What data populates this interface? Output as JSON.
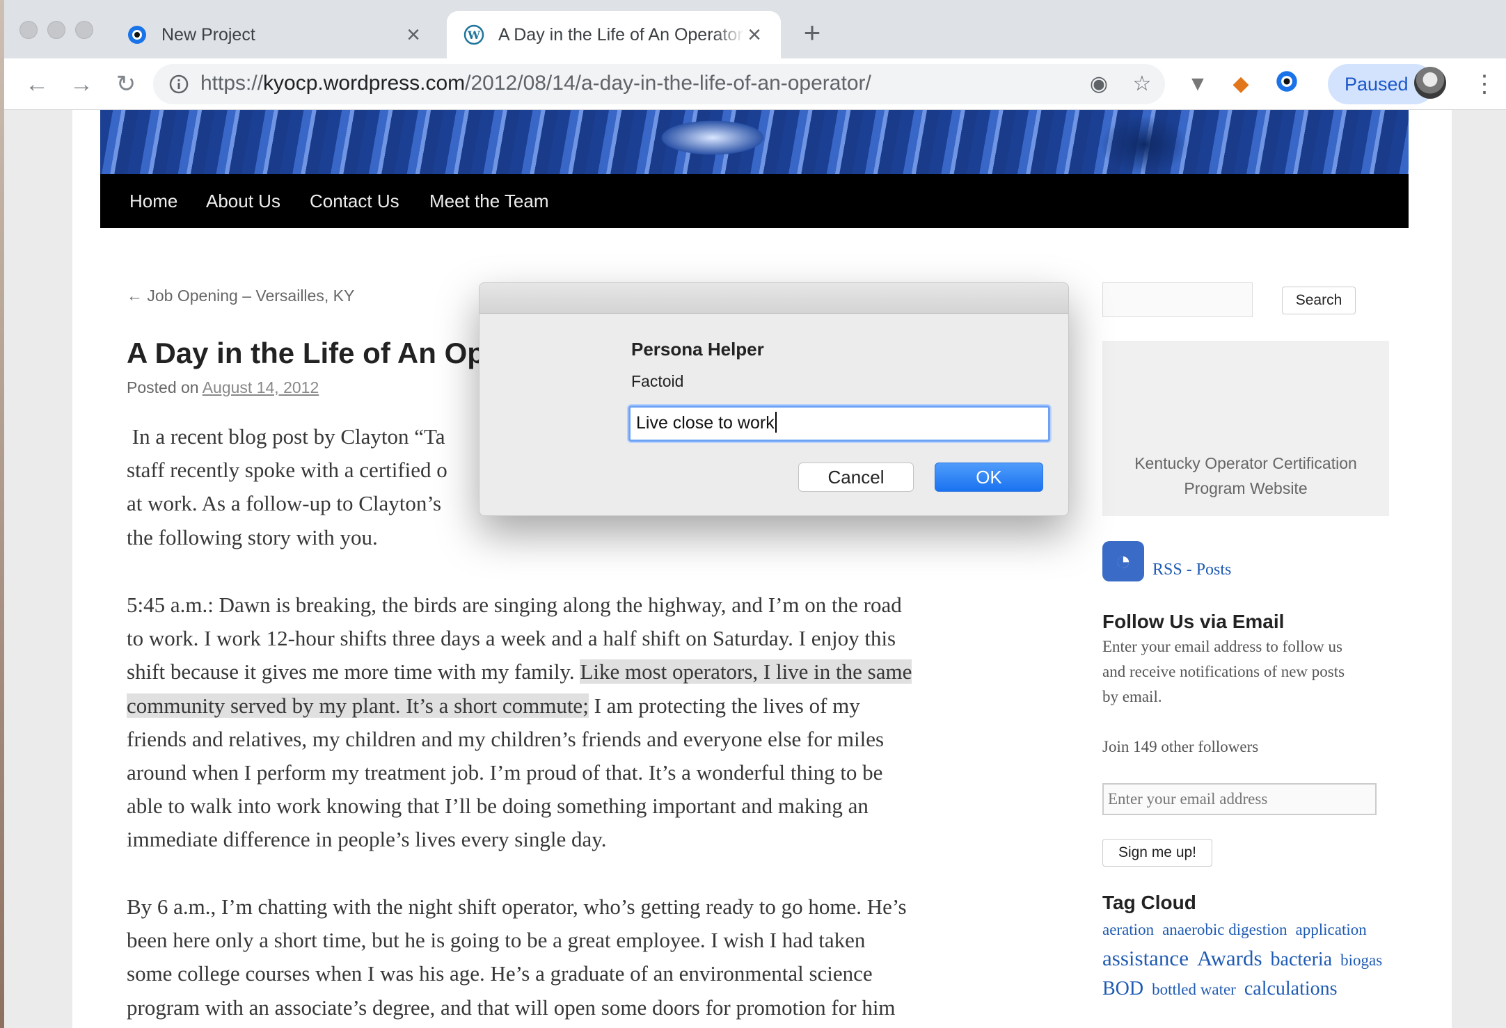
{
  "browser": {
    "tabs": [
      {
        "label": "New Project",
        "icon": "circle-project-icon",
        "active": false
      },
      {
        "label": "A Day in the Life of An Operator",
        "icon": "wordpress-icon",
        "active": true
      }
    ],
    "url_scheme": "https://",
    "url_host": "kyocp.wordpress.com",
    "url_path": "/2012/08/14/a-day-in-the-life-of-an-operator/",
    "profile_label": "Paused"
  },
  "site": {
    "nav": [
      "Home",
      "About Us",
      "Contact Us",
      "Meet the Team"
    ]
  },
  "post": {
    "prev_link": "← Job Opening – Versailles, KY",
    "title": "A Day in the Life of An Operator",
    "posted_on": "Posted on",
    "date": "August 14, 2012",
    "para1_lines": [
      " In a recent blog post by Clayton “Ta",
      "staff recently spoke with a certified o",
      "at work. As a follow-up to Clayton’s",
      "the following story with you."
    ],
    "para2_l1": "5:45 a.m.: Dawn is breaking, the birds are singing along the highway, and I’m on the road",
    "para2_l2": "to work. I work 12-hour shifts three days a week and a half shift on Saturday. I enjoy this",
    "para2_l3a": "shift because it gives me more time with my family. ",
    "para2_l3b": "Like most operators, I live in the same",
    "para2_l4a": "community served by my plant. It’s a short commute;",
    "para2_l4b": " I am protecting the lives of my",
    "para2_rest": [
      "friends and relatives, my children and my children’s friends and everyone else for miles",
      "around when I perform my treatment job. I’m proud of that. It’s a wonderful thing to be",
      "able to walk into work knowing that I’ll be doing something important and making an",
      "immediate difference in people’s lives every single day."
    ],
    "para3_lines": [
      "By 6 a.m., I’m chatting with the night shift operator, who’s getting ready to go home. He’s",
      "been here only a short time, but he is going to be a great employee. I wish I had taken",
      "some college courses when I was his age. He’s a graduate of an environmental science",
      "program with an associate’s degree, and that will open some doors for promotion for him"
    ]
  },
  "sidebar": {
    "search_button": "Search",
    "image_caption_1": "Kentucky Operator Certification",
    "image_caption_2": "Program Website",
    "rss_label": "RSS - Posts",
    "follow_title": "Follow Us via Email",
    "follow_text": [
      "Enter your email address to follow us",
      "and receive notifications of new posts",
      "by email."
    ],
    "followers": "Join 149 other followers",
    "email_placeholder": "Enter your email address",
    "signup_button": "Sign me up!",
    "tag_cloud_title": "Tag Cloud",
    "tags": [
      {
        "t": "aeration",
        "s": 23
      },
      {
        "t": "anaerobic digestion",
        "s": 23
      },
      {
        "t": "application",
        "s": 23
      },
      {
        "t": "assistance",
        "s": 31
      },
      {
        "t": "Awards",
        "s": 31
      },
      {
        "t": "bacteria",
        "s": 28
      },
      {
        "t": "biogas",
        "s": 23
      },
      {
        "t": "BOD",
        "s": 28
      },
      {
        "t": "bottled water",
        "s": 23
      },
      {
        "t": "calculations",
        "s": 28
      }
    ]
  },
  "dialog": {
    "title": "Persona Helper",
    "label": "Factoid",
    "input_value": "Live close to work",
    "cancel": "Cancel",
    "ok": "OK"
  }
}
